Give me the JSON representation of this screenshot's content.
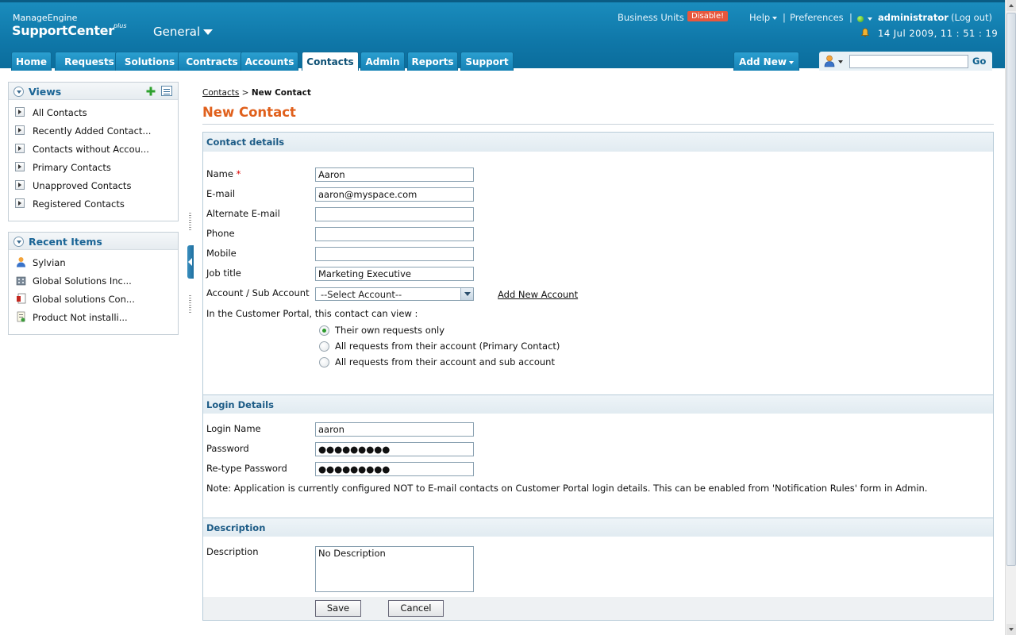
{
  "header": {
    "brand_top": "ManageEngine",
    "brand_name": "SupportCenter",
    "brand_suffix": "plus",
    "portal": "General",
    "business_units_label": "Business Units",
    "disable_badge": "Disable!",
    "help_label": "Help",
    "separator": "|",
    "preferences_label": "Preferences",
    "username": "administrator",
    "logout_label": "(Log out)",
    "datetime": "14 Jul 2009, 11 : 51 : 19",
    "status_color": "#3aa214"
  },
  "tabs": [
    "Home",
    "Requests",
    "Solutions",
    "Contracts",
    "Accounts",
    "Contacts",
    "Admin",
    "Reports",
    "Support"
  ],
  "active_tab": "Contacts",
  "add_new_label": "Add New",
  "search": {
    "value": "",
    "go_label": "Go",
    "icon": "person-search-icon"
  },
  "views_panel": {
    "title": "Views",
    "items": [
      "All Contacts",
      "Recently Added Contact...",
      "Contacts without Accou...",
      "Primary Contacts",
      "Unapproved Contacts",
      "Registered Contacts"
    ]
  },
  "recent_panel": {
    "title": "Recent Items",
    "items": [
      {
        "label": "Sylvian",
        "icon": "contact-person-icon"
      },
      {
        "label": "Global Solutions Inc...",
        "icon": "account-building-icon"
      },
      {
        "label": "Global solutions Con...",
        "icon": "contract-document-icon"
      },
      {
        "label": "Product Not installi...",
        "icon": "request-document-icon"
      }
    ]
  },
  "breadcrumb": {
    "parent": "Contacts",
    "separator": ">",
    "current": "New Contact"
  },
  "page_title": "New Contact",
  "contact_details": {
    "heading": "Contact details",
    "name_label": "Name",
    "required_mark": "*",
    "name_value": "Aaron",
    "email_label": "E-mail",
    "email_value": "aaron@myspace.com",
    "alt_email_label": "Alternate E-mail",
    "alt_email_value": "",
    "phone_label": "Phone",
    "phone_value": "",
    "mobile_label": "Mobile",
    "mobile_value": "",
    "job_title_label": "Job title",
    "job_title_value": "Marketing Executive",
    "account_label": "Account / Sub Account",
    "account_value": "--Select Account--",
    "add_account_link": "Add New Account",
    "portal_view_label": "In the Customer Portal, this contact can view :",
    "portal_options": [
      "Their own requests only",
      "All requests from their account (Primary Contact)",
      "All requests from their account and sub account"
    ],
    "portal_selected": 0
  },
  "login_details": {
    "heading": "Login Details",
    "login_name_label": "Login Name",
    "login_name_value": "aaron",
    "password_label": "Password",
    "password_value": "●●●●●●●●●",
    "retype_label": "Re-type Password",
    "retype_value": "●●●●●●●●●",
    "note": "Note: Application is currently configured NOT to E-mail contacts on Customer Portal login details. This can be enabled from 'Notification Rules' form in Admin."
  },
  "description": {
    "heading": "Description",
    "label": "Description",
    "value": "No Description"
  },
  "buttons": {
    "save": "Save",
    "cancel": "Cancel"
  }
}
